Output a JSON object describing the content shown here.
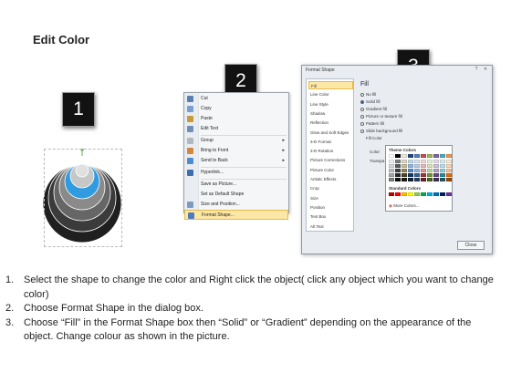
{
  "title": "Edit Color",
  "badges": [
    "1",
    "2",
    "3"
  ],
  "context_menu": {
    "items": [
      {
        "label": "Cut",
        "color": "#5a7fb0"
      },
      {
        "label": "Copy",
        "color": "#7aa0cf"
      },
      {
        "label": "Paste",
        "color": "#c99a3b"
      },
      {
        "label": "Edit Text",
        "color": "#6f8fb8"
      },
      {
        "label": "Group",
        "color": "#b0b8c2",
        "submenu": true
      },
      {
        "label": "Bring to Front",
        "color": "#d4873a",
        "submenu": true
      },
      {
        "label": "Send to Back",
        "color": "#4f8ccf",
        "submenu": true
      },
      {
        "label": "Hyperlink...",
        "color": "#3c6fb0"
      },
      {
        "label": "Save as Picture...",
        "color": null
      },
      {
        "label": "Set as Default Shape",
        "color": null
      },
      {
        "label": "Size and Position...",
        "color": "#7d9ac0"
      },
      {
        "label": "Format Shape...",
        "color": "#4b7cc0",
        "highlighted": true
      }
    ]
  },
  "dialog": {
    "title": "Format Shape",
    "nav": [
      "Fill",
      "Line Color",
      "Line Style",
      "Shadow",
      "Reflection",
      "Glow and Soft Edges",
      "3-D Format",
      "3-D Rotation",
      "Picture Corrections",
      "Picture Color",
      "Artistic Effects",
      "Crop",
      "Size",
      "Position",
      "Text Box",
      "Alt Text"
    ],
    "section": "Fill",
    "options": [
      {
        "label": "No fill",
        "on": false
      },
      {
        "label": "Solid fill",
        "on": true
      },
      {
        "label": "Gradient fill",
        "on": false
      },
      {
        "label": "Picture or texture fill",
        "on": false
      },
      {
        "label": "Pattern fill",
        "on": false
      },
      {
        "label": "Slide background fill",
        "on": false
      }
    ],
    "fill_color_heading": "Fill Color",
    "color_label": "Color:",
    "transparency_label": "Transpa",
    "theme_colors_heading": "Theme Colors",
    "standard_colors_heading": "Standard Colors",
    "more_colors": "More Colors...",
    "close": "Close",
    "theme_top": [
      "#ffffff",
      "#000000",
      "#eeece1",
      "#1f497d",
      "#4f81bd",
      "#c0504d",
      "#9bbb59",
      "#8064a2",
      "#4bacc6",
      "#f79646"
    ],
    "theme_cols": [
      [
        "#f2f2f2",
        "#d9d9d9",
        "#bfbfbf",
        "#a6a6a6",
        "#7f7f7f"
      ],
      [
        "#7f7f7f",
        "#595959",
        "#404040",
        "#262626",
        "#0d0d0d"
      ],
      [
        "#ddd9c3",
        "#c4bd97",
        "#948a54",
        "#4a452a",
        "#1e1c11"
      ],
      [
        "#c6d9f0",
        "#8db3e2",
        "#548dd4",
        "#17365d",
        "#0f243e"
      ],
      [
        "#dbe5f1",
        "#b8cce4",
        "#95b3d7",
        "#366092",
        "#244061"
      ],
      [
        "#f2dcdb",
        "#e5b9b7",
        "#d99694",
        "#953734",
        "#632423"
      ],
      [
        "#ebf1dd",
        "#d7e3bc",
        "#c3d69b",
        "#76923c",
        "#4f6128"
      ],
      [
        "#e5e0ec",
        "#ccc1d9",
        "#b2a2c7",
        "#5f497a",
        "#3f3151"
      ],
      [
        "#dbeef3",
        "#b7dde8",
        "#92cddc",
        "#31859b",
        "#205867"
      ],
      [
        "#fdeada",
        "#fbd5b5",
        "#fac08f",
        "#e36c09",
        "#974806"
      ]
    ],
    "standard": [
      "#c00000",
      "#ff0000",
      "#ffc000",
      "#ffff00",
      "#92d050",
      "#00b050",
      "#00b0f0",
      "#0070c0",
      "#002060",
      "#7030a0"
    ]
  },
  "figure": {
    "rings": [
      "#1f1f1f",
      "#3b3b3b",
      "#666666",
      "#8a8a8a",
      "#2f9be0",
      "#c7c7c7",
      "#e0e0e0"
    ]
  },
  "instructions": [
    {
      "num": "1.",
      "text": "Select the shape to change the color and Right click the object( click any object which you want to change color)"
    },
    {
      "num": "2.",
      "text": "Choose Format Shape in the dialog box."
    },
    {
      "num": "3.",
      "text": "Choose “Fill” in the Format Shape box then “Solid” or “Gradient” depending on the appearance of the object. Change colour as shown in the picture."
    }
  ]
}
